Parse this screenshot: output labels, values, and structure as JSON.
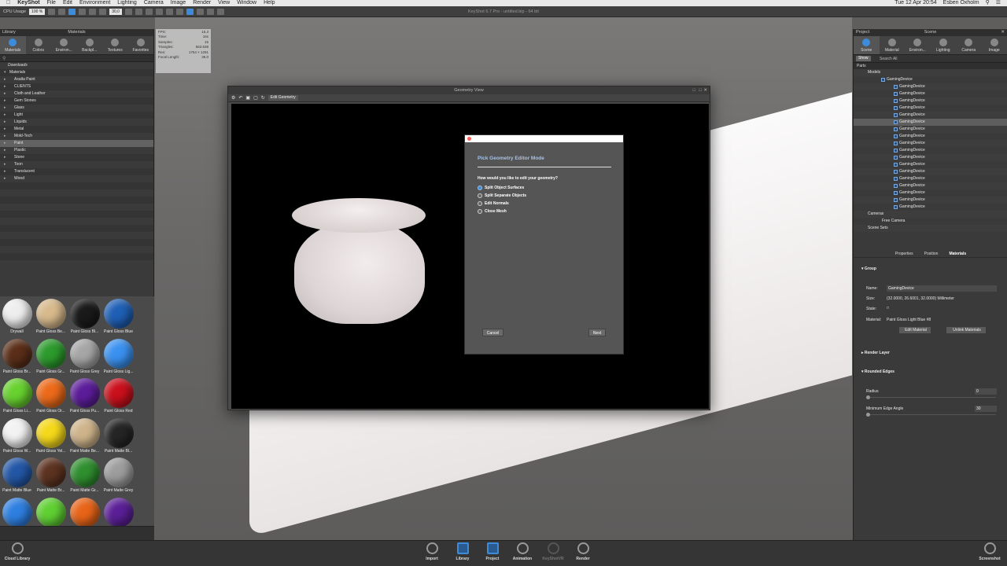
{
  "menubar": {
    "app": "KeyShot",
    "items": [
      "File",
      "Edit",
      "Environment",
      "Lighting",
      "Camera",
      "Image",
      "Render",
      "View",
      "Window",
      "Help"
    ],
    "clock": "Tue 12 Apr  20:54",
    "user": "Esben Oxholm"
  },
  "toolbar": {
    "cpu_label": "CPU Usage",
    "cpu_value": "100 %",
    "fps_field": "30,0"
  },
  "window_title": "KeyShot 6.7 Pro - untitled.bip - 64 bit",
  "library": {
    "header": "Library",
    "panel_title": "Materials",
    "tabs": [
      "Materials",
      "Colors",
      "Environ...",
      "Backpl...",
      "Textures",
      "Favorites"
    ],
    "tree": [
      {
        "label": "Downloads",
        "top": true
      },
      {
        "label": "Materials",
        "top": false,
        "expanded": true
      },
      {
        "label": "Axalta Paint"
      },
      {
        "label": "CLIENTS"
      },
      {
        "label": "Cloth and Leather"
      },
      {
        "label": "Gem Stones"
      },
      {
        "label": "Glass"
      },
      {
        "label": "Light"
      },
      {
        "label": "Liquids"
      },
      {
        "label": "Metal"
      },
      {
        "label": "Mold-Tech"
      },
      {
        "label": "Paint",
        "selected": true
      },
      {
        "label": "Plastic"
      },
      {
        "label": "Stone"
      },
      {
        "label": "Toon"
      },
      {
        "label": "Translucent"
      },
      {
        "label": "Wood"
      }
    ],
    "thumbnails": [
      {
        "label": "Drywall",
        "color": "#eeeeee"
      },
      {
        "label": "Paint Gloss Be...",
        "color": "#d7b98c"
      },
      {
        "label": "Paint Gloss Bl...",
        "color": "#1a1a1a"
      },
      {
        "label": "Paint Gloss Blue",
        "color": "#1f5fb5"
      },
      {
        "label": "Paint Gloss Br...",
        "color": "#5a2e18"
      },
      {
        "label": "Paint Gloss Gr...",
        "color": "#2c9a2c"
      },
      {
        "label": "Paint Gloss Grey",
        "color": "#a6a6a6"
      },
      {
        "label": "Paint Gloss Lig...",
        "color": "#3a91f0"
      },
      {
        "label": "Paint Gloss Li...",
        "color": "#67d12e"
      },
      {
        "label": "Paint Gloss Or...",
        "color": "#ec6a1a"
      },
      {
        "label": "Paint Gloss Pu...",
        "color": "#5c1d9a"
      },
      {
        "label": "Paint Gloss Red",
        "color": "#c9101c"
      },
      {
        "label": "Paint Gloss W...",
        "color": "#f2f2f2"
      },
      {
        "label": "Paint Gloss Yel...",
        "color": "#f4d81a"
      },
      {
        "label": "Paint Matte Be...",
        "color": "#cfb48b"
      },
      {
        "label": "Paint Matte Bl...",
        "color": "#252525"
      },
      {
        "label": "Paint Matte Blue",
        "color": "#2357a6"
      },
      {
        "label": "Paint Matte Br...",
        "color": "#5c3220"
      },
      {
        "label": "Paint Matte Gr...",
        "color": "#2f8f2f"
      },
      {
        "label": "Paint Matte Grey",
        "color": "#9d9d9d"
      },
      {
        "label": "",
        "color": "#2e7fe0"
      },
      {
        "label": "",
        "color": "#5fcf32"
      },
      {
        "label": "",
        "color": "#e86418"
      },
      {
        "label": "",
        "color": "#5a1f96"
      }
    ]
  },
  "stats": [
    {
      "k": "FPS:",
      "v": "15.3"
    },
    {
      "k": "Time:",
      "v": "16s"
    },
    {
      "k": "Samples:",
      "v": "15"
    },
    {
      "k": "Triangles:",
      "v": "563.638"
    },
    {
      "k": "Res:",
      "v": "1754 × 1291"
    },
    {
      "k": "Focal Length:",
      "v": "35.0"
    }
  ],
  "geometry_view": {
    "title": "Geometry View",
    "edit_button": "Edit Geometry"
  },
  "dialog": {
    "heading": "Pick Geometry Editor Mode",
    "question": "How would you like to edit your geometry?",
    "options": [
      {
        "label": "Split Object Surfaces",
        "selected": true
      },
      {
        "label": "Split Separate Objects",
        "selected": false
      },
      {
        "label": "Edit Normals",
        "selected": false
      },
      {
        "label": "Close Mesh",
        "selected": false
      }
    ],
    "cancel": "Cancel",
    "next": "Next"
  },
  "project": {
    "header": "Project",
    "panel_title": "Scene",
    "tabs": [
      "Scene",
      "Material",
      "Environ...",
      "Lighting",
      "Camera",
      "Image"
    ],
    "show_btn": "Show",
    "search_placeholder": "Search All",
    "parts_label": "Parts",
    "models_label": "Models",
    "root_model": "GamingDevice",
    "parts": [
      "GamingDevice",
      "GamingDevice",
      "GamingDevice",
      "GamingDevice",
      "GamingDevice",
      "GamingDevice",
      "GamingDevice",
      "GamingDevice",
      "GamingDevice",
      "GamingDevice",
      "GamingDevice",
      "GamingDevice",
      "GamingDevice",
      "GamingDevice",
      "GamingDevice",
      "GamingDevice",
      "GamingDevice",
      "GamingDevice"
    ],
    "cameras_label": "Cameras",
    "free_camera": "Free Camera",
    "scene_sets": "Scene Sets",
    "prop_tabs": [
      "Properties",
      "Position",
      "Materials"
    ],
    "group_label": "Group",
    "name_label": "Name:",
    "name_value": "GamingDevice",
    "size_label": "Size:",
    "size_value": "(32.0000, 26.6001, 32.0000) Millimeter",
    "state_label": "State:",
    "material_label": "Material:",
    "material_value": "Paint Gloss Light Blue #8",
    "edit_material": "Edit Material",
    "unlink_materials": "Unlink Materials",
    "render_layer": "Render Layer",
    "rounded_edges": "Rounded Edges",
    "radius_label": "Radius",
    "radius_value": "0",
    "min_edge_label": "Minimum Edge Angle",
    "min_edge_value": "30"
  },
  "bottom": {
    "cloud_library": "Cloud Library",
    "items": [
      "Import",
      "Library",
      "Project",
      "Animation",
      "KeyShotVR",
      "Render"
    ],
    "screenshot": "Screenshot"
  }
}
